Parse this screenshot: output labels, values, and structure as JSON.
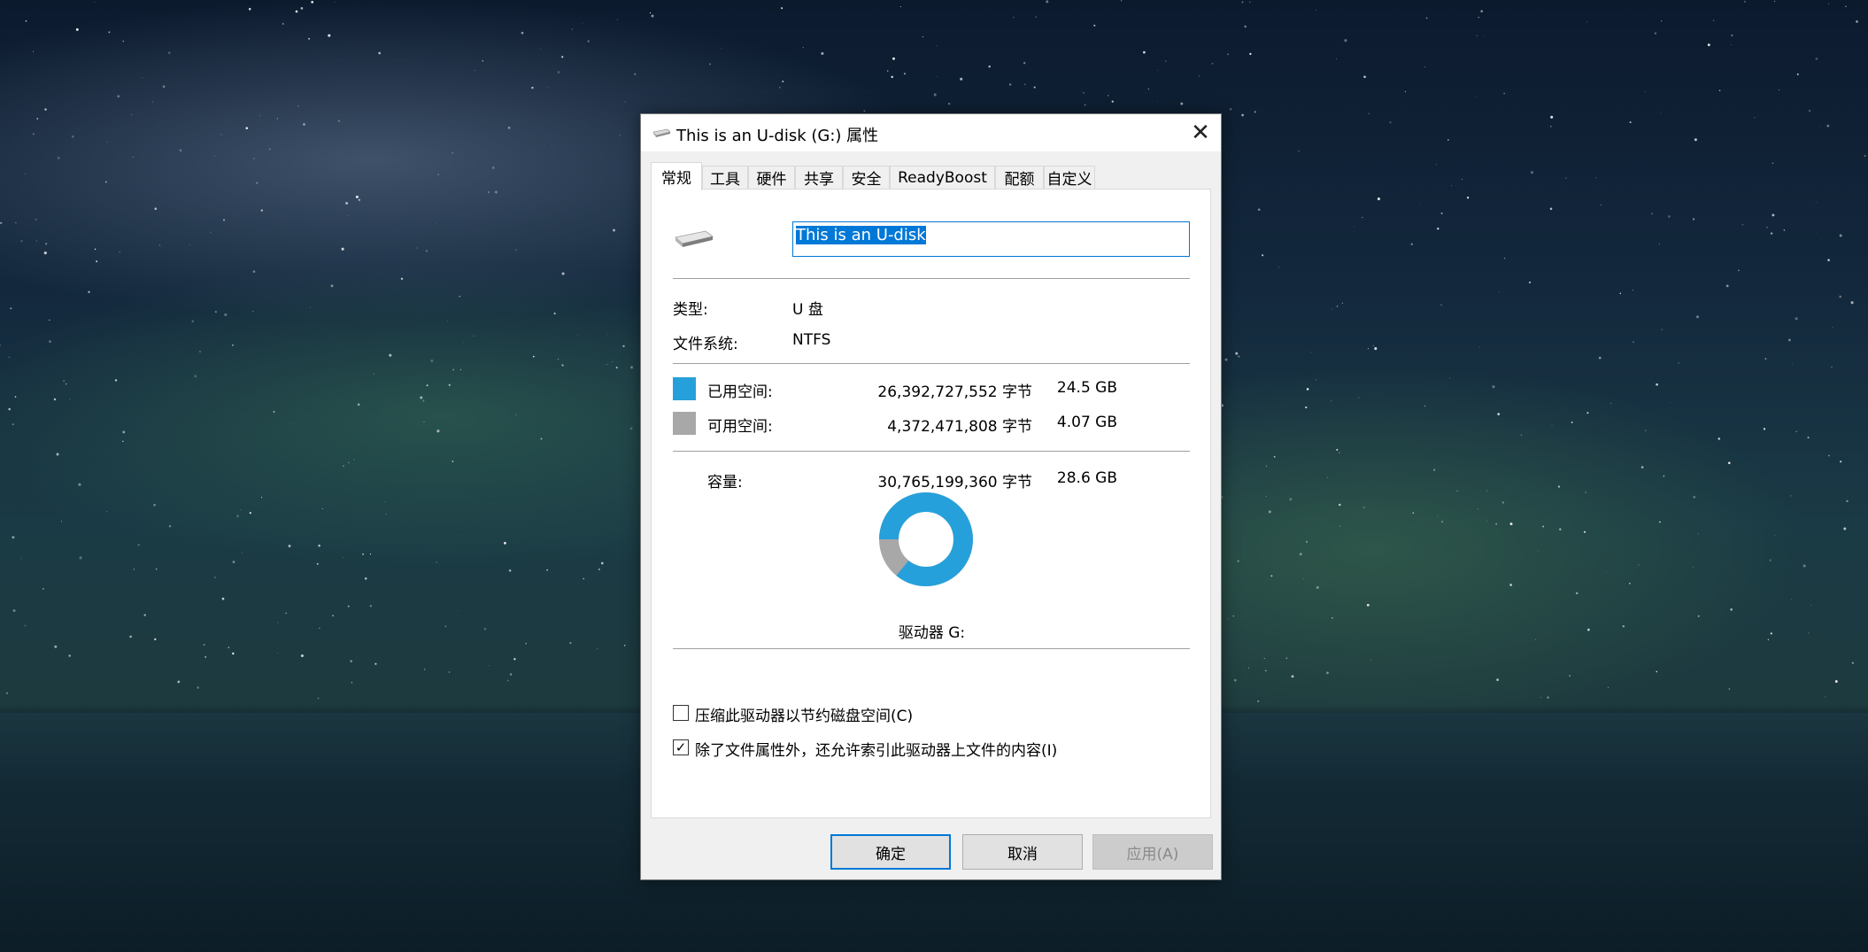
{
  "window": {
    "title": "This is an U-disk (G:) 属性",
    "close_icon": "close-icon"
  },
  "tabs": [
    {
      "label": "常规",
      "active": true
    },
    {
      "label": "工具"
    },
    {
      "label": "硬件"
    },
    {
      "label": "共享"
    },
    {
      "label": "安全"
    },
    {
      "label": "ReadyBoost"
    },
    {
      "label": "配额"
    },
    {
      "label": "自定义"
    }
  ],
  "general": {
    "drive_name": "This is an U-disk",
    "type_label": "类型:",
    "type_value": "U 盘",
    "fs_label": "文件系统:",
    "fs_value": "NTFS",
    "used": {
      "label": "已用空间:",
      "bytes": "26,392,727,552 字节",
      "size": "24.5 GB",
      "color": "#26a0da"
    },
    "free": {
      "label": "可用空间:",
      "bytes": "4,372,471,808 字节",
      "size": "4.07 GB",
      "color": "#a8a8a8"
    },
    "capacity": {
      "label": "容量:",
      "bytes": "30,765,199,360 字节",
      "size": "28.6 GB"
    },
    "used_fraction": 0.858,
    "drive_label": "驱动器 G:",
    "compress_label": "压缩此驱动器以节约磁盘空间(C)",
    "compress_checked": false,
    "index_label": "除了文件属性外，还允许索引此驱动器上文件的内容(I)",
    "index_checked": true
  },
  "buttons": {
    "ok": "确定",
    "cancel": "取消",
    "apply": "应用(A)"
  }
}
